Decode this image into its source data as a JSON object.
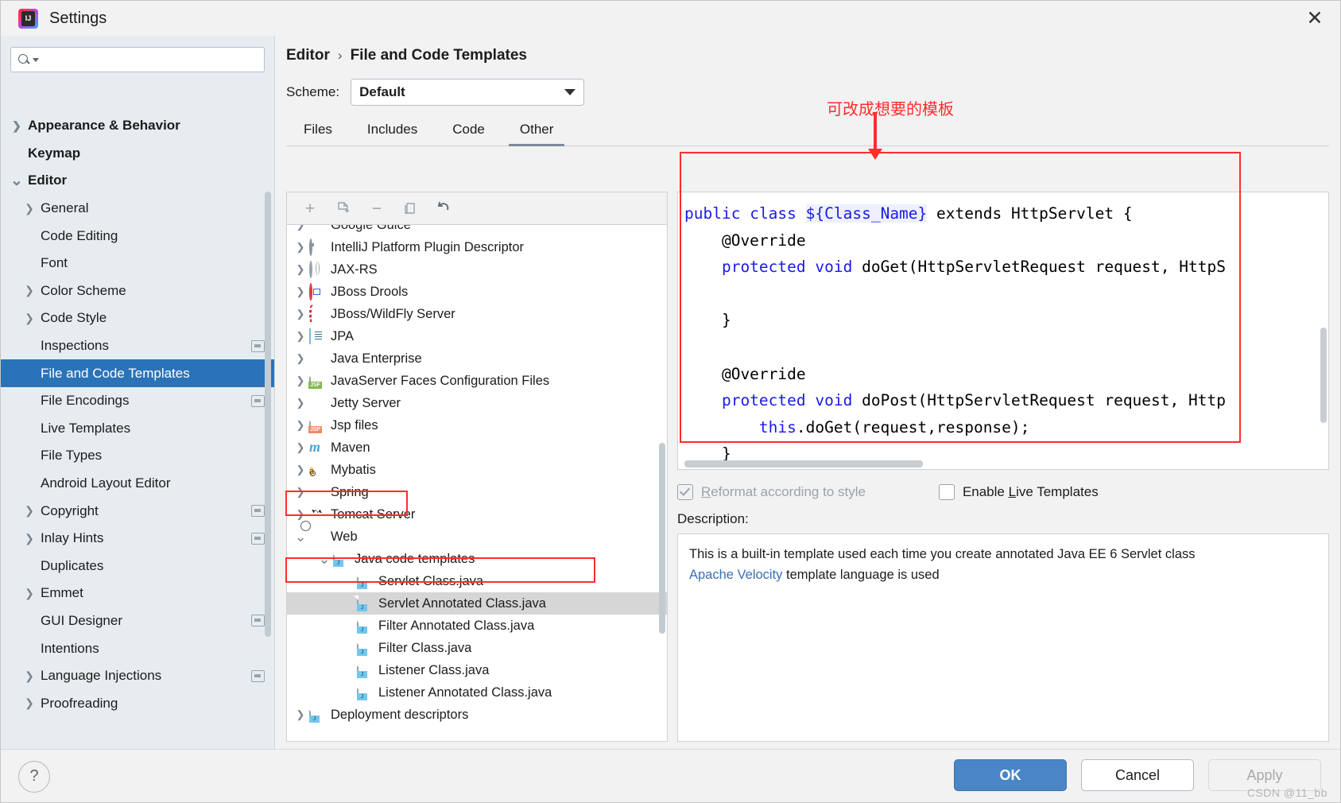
{
  "window": {
    "title": "Settings",
    "logo_icon": "intellij-idea-logo",
    "close_icon": "close-icon"
  },
  "search": {
    "placeholder": "",
    "value": "",
    "icon": "search-icon"
  },
  "sidebar": {
    "items": [
      {
        "label": "Appearance & Behavior",
        "level": 0,
        "arrow": "chevron-right",
        "bold": true,
        "selected": false,
        "badge": false
      },
      {
        "label": "Keymap",
        "level": 0,
        "arrow": "",
        "bold": true,
        "selected": false,
        "badge": false
      },
      {
        "label": "Editor",
        "level": 0,
        "arrow": "chevron-down",
        "bold": true,
        "selected": false,
        "badge": false
      },
      {
        "label": "General",
        "level": 1,
        "arrow": "chevron-right",
        "bold": false,
        "selected": false,
        "badge": false
      },
      {
        "label": "Code Editing",
        "level": 1,
        "arrow": "",
        "bold": false,
        "selected": false,
        "badge": false
      },
      {
        "label": "Font",
        "level": 1,
        "arrow": "",
        "bold": false,
        "selected": false,
        "badge": false
      },
      {
        "label": "Color Scheme",
        "level": 1,
        "arrow": "chevron-right",
        "bold": false,
        "selected": false,
        "badge": false
      },
      {
        "label": "Code Style",
        "level": 1,
        "arrow": "chevron-right",
        "bold": false,
        "selected": false,
        "badge": false
      },
      {
        "label": "Inspections",
        "level": 1,
        "arrow": "",
        "bold": false,
        "selected": false,
        "badge": true
      },
      {
        "label": "File and Code Templates",
        "level": 1,
        "arrow": "",
        "bold": false,
        "selected": true,
        "badge": false
      },
      {
        "label": "File Encodings",
        "level": 1,
        "arrow": "",
        "bold": false,
        "selected": false,
        "badge": true
      },
      {
        "label": "Live Templates",
        "level": 1,
        "arrow": "",
        "bold": false,
        "selected": false,
        "badge": false
      },
      {
        "label": "File Types",
        "level": 1,
        "arrow": "",
        "bold": false,
        "selected": false,
        "badge": false
      },
      {
        "label": "Android Layout Editor",
        "level": 1,
        "arrow": "",
        "bold": false,
        "selected": false,
        "badge": false
      },
      {
        "label": "Copyright",
        "level": 1,
        "arrow": "chevron-right",
        "bold": false,
        "selected": false,
        "badge": true
      },
      {
        "label": "Inlay Hints",
        "level": 1,
        "arrow": "chevron-right",
        "bold": false,
        "selected": false,
        "badge": true
      },
      {
        "label": "Duplicates",
        "level": 1,
        "arrow": "",
        "bold": false,
        "selected": false,
        "badge": false
      },
      {
        "label": "Emmet",
        "level": 1,
        "arrow": "chevron-right",
        "bold": false,
        "selected": false,
        "badge": false
      },
      {
        "label": "GUI Designer",
        "level": 1,
        "arrow": "",
        "bold": false,
        "selected": false,
        "badge": true
      },
      {
        "label": "Intentions",
        "level": 1,
        "arrow": "",
        "bold": false,
        "selected": false,
        "badge": false
      },
      {
        "label": "Language Injections",
        "level": 1,
        "arrow": "chevron-right",
        "bold": false,
        "selected": false,
        "badge": true
      },
      {
        "label": "Proofreading",
        "level": 1,
        "arrow": "chevron-right",
        "bold": false,
        "selected": false,
        "badge": false
      }
    ]
  },
  "breadcrumb": {
    "parent": "Editor",
    "separator": "›",
    "current": "File and Code Templates"
  },
  "scheme": {
    "label": "Scheme:",
    "value": "Default",
    "dropdown_icon": "chevron-down-icon"
  },
  "tabs": [
    {
      "label": "Files",
      "active": false
    },
    {
      "label": "Includes",
      "active": false
    },
    {
      "label": "Code",
      "active": false
    },
    {
      "label": "Other",
      "active": true
    }
  ],
  "toolbar": {
    "add_icon": "plus-icon",
    "copy_template_icon": "copy-template-icon",
    "remove_icon": "minus-icon",
    "duplicate_icon": "duplicate-icon",
    "reset_icon": "undo-icon"
  },
  "template_tree": [
    {
      "label": "Google Guice",
      "indent": 1,
      "arrow": "chevron-right",
      "icon": "google-guice-icon",
      "selected": false,
      "clipped": true
    },
    {
      "label": "IntelliJ Platform Plugin Descriptor",
      "indent": 1,
      "arrow": "chevron-right",
      "icon": "plugin-descriptor-icon",
      "selected": false
    },
    {
      "label": "JAX-RS",
      "indent": 1,
      "arrow": "chevron-right",
      "icon": "jaxrs-globe-icon",
      "selected": false
    },
    {
      "label": "JBoss Drools",
      "indent": 1,
      "arrow": "chevron-right",
      "icon": "jboss-drools-icon",
      "selected": false
    },
    {
      "label": "JBoss/WildFly Server",
      "indent": 1,
      "arrow": "chevron-right",
      "icon": "wildfly-icon",
      "selected": false
    },
    {
      "label": "JPA",
      "indent": 1,
      "arrow": "chevron-right",
      "icon": "jpa-icon",
      "selected": false
    },
    {
      "label": "Java Enterprise",
      "indent": 1,
      "arrow": "chevron-right",
      "icon": "java-enterprise-icon",
      "selected": false
    },
    {
      "label": "JavaServer Faces Configuration Files",
      "indent": 1,
      "arrow": "chevron-right",
      "icon": "jsf-file-icon",
      "selected": false
    },
    {
      "label": "Jetty Server",
      "indent": 1,
      "arrow": "chevron-right",
      "icon": "jetty-icon",
      "selected": false
    },
    {
      "label": "Jsp files",
      "indent": 1,
      "arrow": "chevron-right",
      "icon": "jsp-file-icon",
      "selected": false
    },
    {
      "label": "Maven",
      "indent": 1,
      "arrow": "chevron-right",
      "icon": "maven-icon",
      "selected": false
    },
    {
      "label": "Mybatis",
      "indent": 1,
      "arrow": "chevron-right",
      "icon": "mybatis-icon",
      "selected": false
    },
    {
      "label": "Spring",
      "indent": 1,
      "arrow": "chevron-right",
      "icon": "spring-leaf-icon",
      "selected": false
    },
    {
      "label": "Tomcat Server",
      "indent": 1,
      "arrow": "chevron-right",
      "icon": "tomcat-icon",
      "selected": false
    },
    {
      "label": "Web",
      "indent": 1,
      "arrow": "chevron-down",
      "icon": "web-icon",
      "selected": false,
      "highlighted": true
    },
    {
      "label": "Java code templates",
      "indent": 2,
      "arrow": "chevron-down",
      "icon": "java-file-icon",
      "selected": false
    },
    {
      "label": "Servlet Class.java",
      "indent": 3,
      "arrow": "",
      "icon": "java-file-icon",
      "selected": false
    },
    {
      "label": "Servlet Annotated Class.java",
      "indent": 3,
      "arrow": "",
      "icon": "java-file-icon",
      "selected": true,
      "highlighted": true
    },
    {
      "label": "Filter Annotated Class.java",
      "indent": 3,
      "arrow": "",
      "icon": "java-file-icon",
      "selected": false
    },
    {
      "label": "Filter Class.java",
      "indent": 3,
      "arrow": "",
      "icon": "java-file-icon",
      "selected": false
    },
    {
      "label": "Listener Class.java",
      "indent": 3,
      "arrow": "",
      "icon": "java-file-icon",
      "selected": false
    },
    {
      "label": "Listener Annotated Class.java",
      "indent": 3,
      "arrow": "",
      "icon": "java-file-icon",
      "selected": false
    },
    {
      "label": "Deployment descriptors",
      "indent": 1,
      "arrow": "chevron-right",
      "icon": "deployment-descriptor-icon",
      "selected": false,
      "clipped": true
    }
  ],
  "editor": {
    "lines": [
      [
        {
          "t": "public",
          "c": "kw"
        },
        {
          "t": " ",
          "c": ""
        },
        {
          "t": "class",
          "c": "kw"
        },
        {
          "t": " ",
          "c": ""
        },
        {
          "t": "${Class_Name}",
          "c": "var"
        },
        {
          "t": " extends HttpServlet {",
          "c": ""
        }
      ],
      [
        {
          "t": "    @Override",
          "c": ""
        }
      ],
      [
        {
          "t": "    ",
          "c": ""
        },
        {
          "t": "protected",
          "c": "kw"
        },
        {
          "t": " ",
          "c": ""
        },
        {
          "t": "void",
          "c": "kw"
        },
        {
          "t": " doGet(HttpServletRequest request, HttpS",
          "c": ""
        }
      ],
      [
        {
          "t": "",
          "c": ""
        }
      ],
      [
        {
          "t": "    }",
          "c": ""
        }
      ],
      [
        {
          "t": "",
          "c": ""
        }
      ],
      [
        {
          "t": "    @Override",
          "c": ""
        }
      ],
      [
        {
          "t": "    ",
          "c": ""
        },
        {
          "t": "protected",
          "c": "kw"
        },
        {
          "t": " ",
          "c": ""
        },
        {
          "t": "void",
          "c": "kw"
        },
        {
          "t": " doPost(HttpServletRequest request, Http",
          "c": ""
        }
      ],
      [
        {
          "t": "        ",
          "c": ""
        },
        {
          "t": "this",
          "c": "kw"
        },
        {
          "t": ".doGet(request,response);",
          "c": ""
        }
      ],
      [
        {
          "t": "    }",
          "c": ""
        }
      ]
    ]
  },
  "options": {
    "reformat": {
      "label": "Reformat according to style",
      "checked": true,
      "enabled": false,
      "mnemonic": "R"
    },
    "live_templates": {
      "label": "Enable Live Templates",
      "checked": false,
      "enabled": true,
      "mnemonic": "L"
    }
  },
  "description": {
    "label": "Description:",
    "line1": "This is a built-in template used each time you create annotated Java EE 6 Servlet class",
    "link_text": "Apache Velocity",
    "line2_rest": " template language is used"
  },
  "footer": {
    "help_icon": "help-icon",
    "ok": "OK",
    "cancel": "Cancel",
    "apply": "Apply"
  },
  "annotations": {
    "note_text": "可改成想要的模板",
    "color": "#ff2d2d"
  },
  "watermark": "CSDN @11_bb"
}
